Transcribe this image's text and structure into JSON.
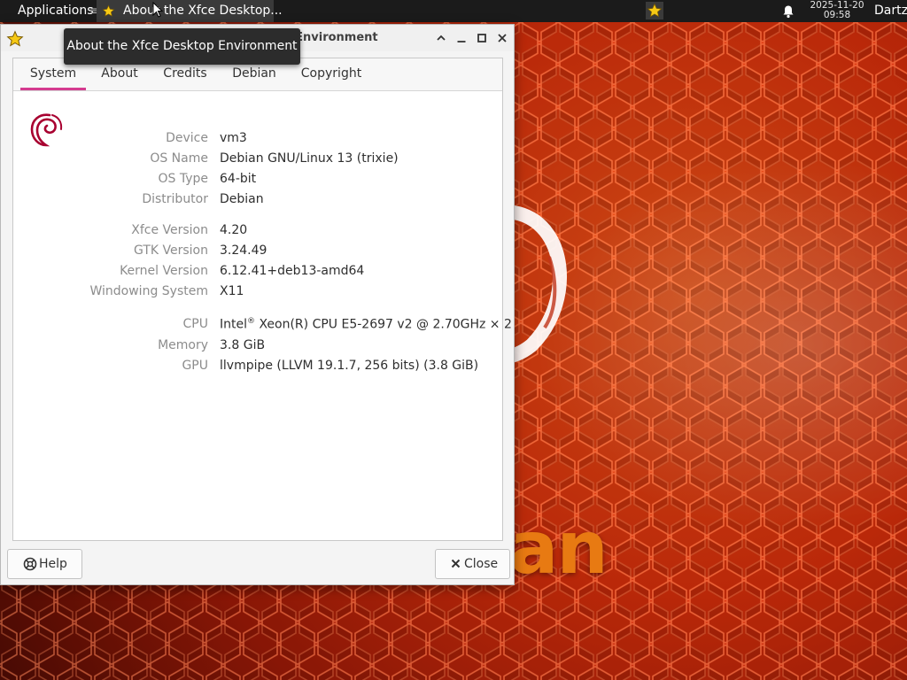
{
  "panel": {
    "applications_label": "Applications",
    "applications_sep": "≡",
    "task_label": "About the Xfce Desktop...",
    "clock_date": "2025-11-20",
    "clock_time": "09:58",
    "user": "Dartz"
  },
  "tooltip": {
    "text": "About the Xfce Desktop Environment"
  },
  "window": {
    "title": "About the Xfce Desktop Environment",
    "tabs": [
      "System",
      "About",
      "Credits",
      "Debian",
      "Copyright"
    ],
    "active_tab": "System",
    "info": [
      {
        "label": "Device",
        "value": "vm3"
      },
      {
        "label": "OS Name",
        "value": "Debian GNU/Linux 13 (trixie)"
      },
      {
        "label": "OS Type",
        "value": "64-bit"
      },
      {
        "label": "Distributor",
        "value": "Debian"
      },
      {
        "label": "Xfce Version",
        "value": "4.20"
      },
      {
        "label": "GTK Version",
        "value": "3.24.49"
      },
      {
        "label": "Kernel Version",
        "value": "6.12.41+deb13-amd64"
      },
      {
        "label": "Windowing System",
        "value": "X11"
      },
      {
        "label": "CPU",
        "value_pre": "Intel",
        "value_sup": "®",
        "value_post": " Xeon(R) CPU E5-2697 v2 @ 2.70GHz × 2"
      },
      {
        "label": "Memory",
        "value": "3.8 GiB"
      },
      {
        "label": "GPU",
        "value": "llvmpipe (LLVM 19.1.7, 256 bits) (3.8 GiB)"
      }
    ],
    "help_label": "Help",
    "close_label": "Close"
  },
  "desktop": {
    "wallpaper_text": "an"
  },
  "colors": {
    "accent": "#d43b8f",
    "panel_bg": "#1b1b1b",
    "debian_red": "#a80030"
  }
}
